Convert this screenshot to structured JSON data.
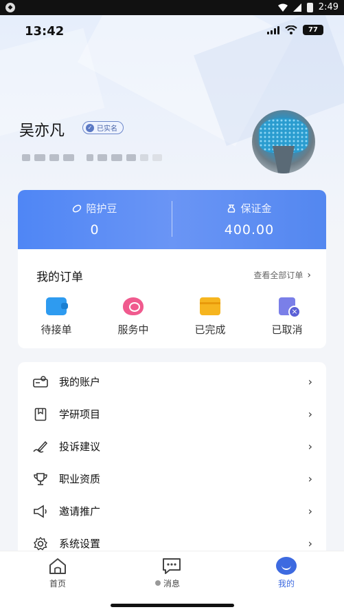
{
  "android_status": {
    "time": "2:49"
  },
  "ios_status": {
    "time": "13:42",
    "battery": "77"
  },
  "profile": {
    "name": "吴亦凡",
    "verified_label": "已实名"
  },
  "wallet": {
    "points_label": "陪护豆",
    "points_value": "0",
    "deposit_label": "保证金",
    "deposit_value": "400.00"
  },
  "orders": {
    "title": "我的订单",
    "view_all": "查看全部订单",
    "items": [
      {
        "label": "待接单",
        "icon": "wallet-icon"
      },
      {
        "label": "服务中",
        "icon": "heart-hands-icon"
      },
      {
        "label": "已完成",
        "icon": "box-icon"
      },
      {
        "label": "已取消",
        "icon": "cancel-doc-icon"
      }
    ]
  },
  "menu": {
    "items": [
      {
        "label": "我的账户",
        "icon": "account-card-icon"
      },
      {
        "label": "学研项目",
        "icon": "bookmark-icon"
      },
      {
        "label": "投诉建议",
        "icon": "pen-icon"
      },
      {
        "label": "职业资质",
        "icon": "trophy-icon"
      },
      {
        "label": "邀请推广",
        "icon": "megaphone-icon"
      },
      {
        "label": "系统设置",
        "icon": "gear-icon"
      }
    ]
  },
  "tabbar": {
    "tabs": [
      {
        "label": "首页",
        "icon": "home-icon"
      },
      {
        "label": "消息",
        "icon": "message-icon"
      },
      {
        "label": "我的",
        "icon": "me-icon"
      }
    ],
    "active_color": "#3d6ae0"
  },
  "colors": {
    "accent": "#4f86f5"
  }
}
